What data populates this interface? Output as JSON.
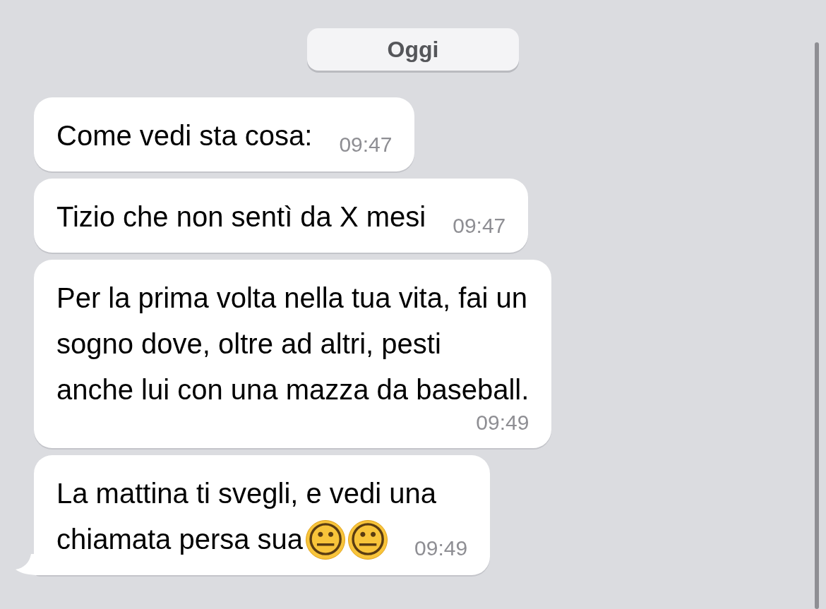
{
  "date_pill": "Oggi",
  "messages": [
    {
      "lines": [
        "Come vedi sta cosa:"
      ],
      "time": "09:47",
      "time_own_line": false,
      "tail": false
    },
    {
      "lines": [
        "Tizio che non sentì da X mesi"
      ],
      "time": "09:47",
      "time_own_line": false,
      "tail": false
    },
    {
      "lines": [
        "Per la prima volta nella tua vita, fai un",
        "sogno dove, oltre ad altri, pesti",
        "anche lui con una mazza da baseball."
      ],
      "time": "09:49",
      "time_own_line": true,
      "tail": false
    },
    {
      "lines": [
        "La mattina ti svegli, e vedi una",
        "chiamata persa sua"
      ],
      "emoji": [
        "😐",
        "😐"
      ],
      "time": "09:49",
      "time_own_line": false,
      "tail": true
    }
  ]
}
